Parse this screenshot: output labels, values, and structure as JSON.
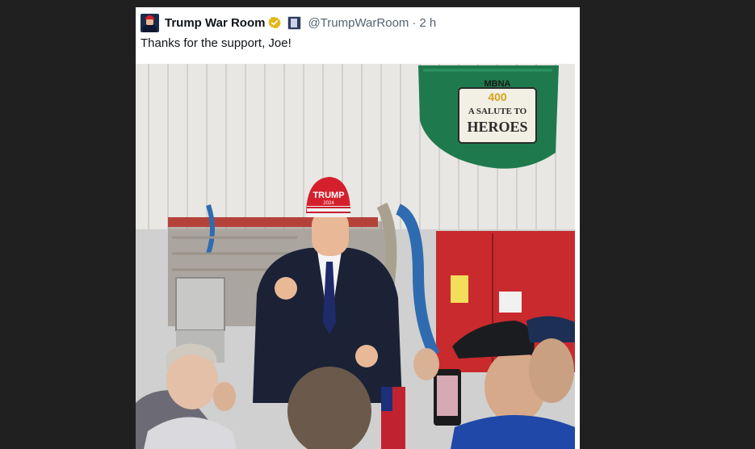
{
  "tweet": {
    "display_name": "Trump War Room",
    "handle": "@TrumpWarRoom",
    "separator": "·",
    "time": "2 h",
    "text": "Thanks for the support, Joe!",
    "icons": {
      "avatar": "avatar",
      "verified": "verified-badge-icon",
      "affiliate": "affiliate-badge-icon"
    },
    "verified_color": "#e2b719"
  },
  "photo": {
    "banner_line1": "MBNA",
    "banner_line2": "400",
    "banner_line3": "A SALUTE TO",
    "banner_line4": "HEROES",
    "cap_text": "TRUMP",
    "cap_year": "2024"
  }
}
